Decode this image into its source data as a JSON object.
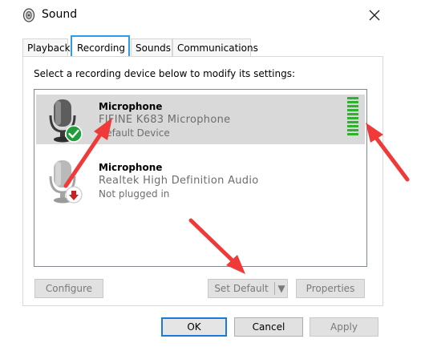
{
  "window": {
    "title": "Sound",
    "title_icon": "speaker-icon",
    "close_icon": "close-icon"
  },
  "tabs": [
    {
      "label": "Playback",
      "active": false
    },
    {
      "label": "Recording",
      "active": true
    },
    {
      "label": "Sounds",
      "active": false
    },
    {
      "label": "Communications",
      "active": false
    }
  ],
  "instructions": "Select a recording device below to modify its settings:",
  "devices": [
    {
      "name": "Microphone",
      "description": "FIFINE K683 Microphone",
      "status": "Default Device",
      "selected": true,
      "badge_icon": "green-check-icon",
      "level": 1.0
    },
    {
      "name": "Microphone",
      "description": "Realtek High Definition Audio",
      "status": "Not plugged in",
      "selected": false,
      "badge_icon": "red-down-arrow-icon"
    }
  ],
  "buttons": {
    "configure": "Configure",
    "set_default": "Set Default",
    "set_default_arrow": "▼",
    "properties": "Properties",
    "ok": "OK",
    "cancel": "Cancel",
    "apply": "Apply"
  },
  "colors": {
    "tab_highlight": "#2a9ee8",
    "selected_row": "#d9d9d9",
    "level_green": "#2db42d",
    "annotation_arrow": "#f03a3a"
  }
}
